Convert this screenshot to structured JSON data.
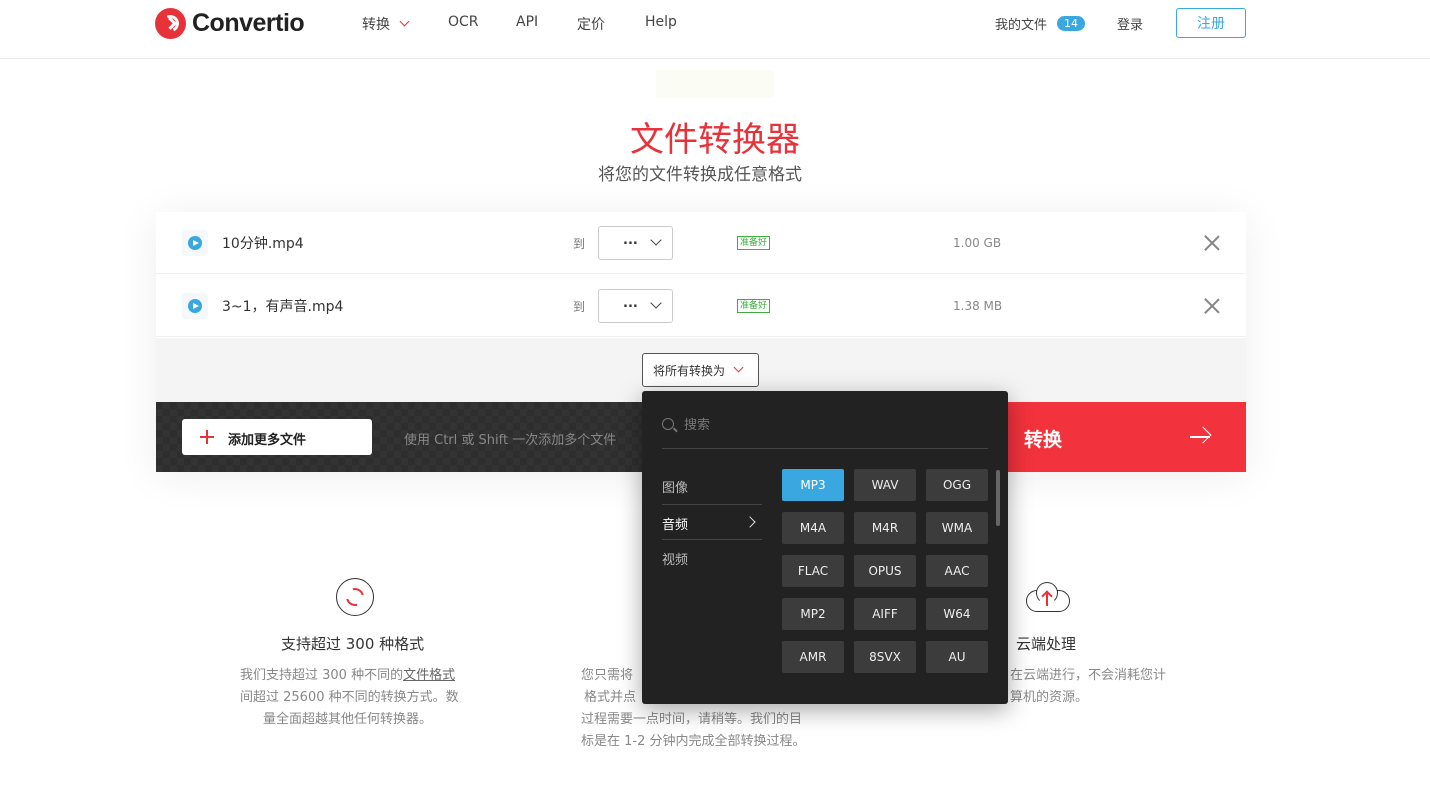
{
  "header": {
    "logo_text": "Convertio",
    "nav": [
      {
        "label": "转换"
      },
      {
        "label": "OCR"
      },
      {
        "label": "API"
      },
      {
        "label": "定价"
      },
      {
        "label": "Help"
      }
    ],
    "my_files_label": "我的文件",
    "my_files_count": "14",
    "login_label": "登录",
    "signup_label": "注册"
  },
  "hero": {
    "title": "文件转换器",
    "subtitle": "将您的文件转换成任意格式"
  },
  "files": [
    {
      "name": "10分钟.mp4",
      "to_label": "到",
      "format": "...",
      "status": "准备好",
      "size": "1.00 GB"
    },
    {
      "name": "3~1，有声音.mp4",
      "to_label": "到",
      "format": "...",
      "status": "准备好",
      "size": "1.38 MB"
    }
  ],
  "convert_all_label": "将所有转换为",
  "actions": {
    "add_more_label": "添加更多文件",
    "hint": "使用 Ctrl 或 Shift 一次添加多个文件",
    "convert_label": "转换"
  },
  "dropdown": {
    "search_placeholder": "搜索",
    "categories": [
      {
        "label": "图像"
      },
      {
        "label": "音频"
      },
      {
        "label": "视频"
      }
    ],
    "active_category": "音频",
    "formats": [
      "MP3",
      "WAV",
      "OGG",
      "M4A",
      "M4R",
      "WMA",
      "FLAC",
      "OPUS",
      "AAC",
      "MP2",
      "AIFF",
      "W64",
      "AMR",
      "8SVX",
      "AU"
    ],
    "selected_format": "MP3"
  },
  "features": [
    {
      "title": "支持超过 300 种格式",
      "desc_lines": [
        "我们支持超过 300 种不同的",
        "文件格式",
        "间超过 25600 种不同的转换方式。数",
        "量全面超越其他任何转换器。"
      ]
    },
    {
      "title": "",
      "desc_lines": [
        "您只需将",
        "格式并点",
        "过程需要一点时间，请稍等。我们的目",
        "标是在 1-2 分钟内完成全部转换过程。"
      ]
    },
    {
      "title": "云端处理",
      "desc_lines": [
        "在云端进行，不会消耗您计",
        "算机的资源。"
      ]
    }
  ],
  "colors": {
    "brand_red": "#e8323a",
    "accent_blue": "#3aa8e0",
    "status_green": "#3cae3c",
    "dropdown_bg": "#222222"
  }
}
